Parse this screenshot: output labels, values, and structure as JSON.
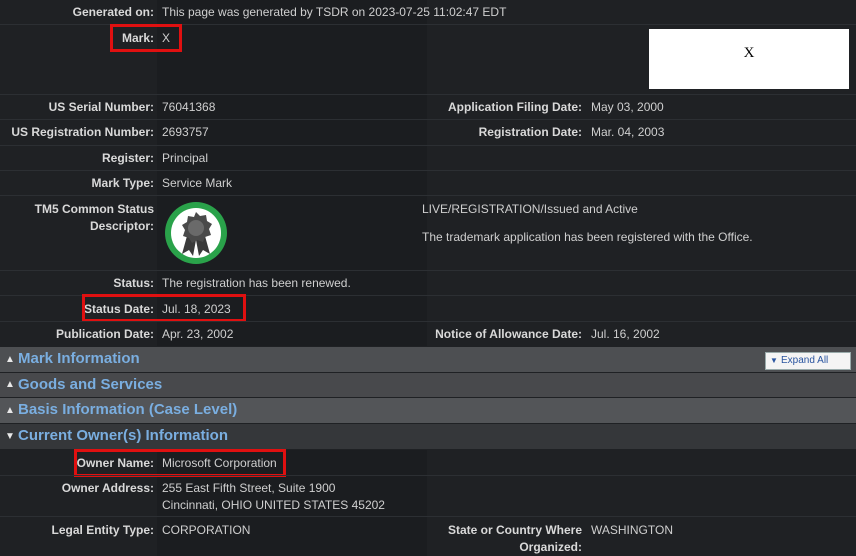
{
  "header": {
    "generated_label": "Generated on:",
    "generated_value": "This page was generated by TSDR on 2023-07-25 11:02:47 EDT"
  },
  "mark": {
    "label": "Mark:",
    "value": "X",
    "image_text": "X"
  },
  "fields": {
    "serial_label": "US Serial Number:",
    "serial_value": "76041368",
    "filing_label": "Application Filing Date:",
    "filing_value": "May 03, 2000",
    "regnum_label": "US Registration Number:",
    "regnum_value": "2693757",
    "regdate_label": "Registration Date:",
    "regdate_value": "Mar. 04, 2003",
    "register_label": "Register:",
    "register_value": "Principal",
    "marktype_label": "Mark Type:",
    "marktype_value": "Service Mark",
    "tm5_label_1": "TM5 Common Status",
    "tm5_label_2": "Descriptor:",
    "tm5_status": "LIVE/REGISTRATION/Issued and Active",
    "tm5_desc": "The trademark application has been registered with the Office.",
    "status_label": "Status:",
    "status_value": "The registration has been renewed.",
    "statusdate_label": "Status Date:",
    "statusdate_value": "Jul. 18, 2023",
    "pubdate_label": "Publication Date:",
    "pubdate_value": "Apr. 23, 2002",
    "allowance_label": "Notice of Allowance Date:",
    "allowance_value": "Jul. 16, 2002"
  },
  "sections": {
    "mark_info": "Mark Information",
    "goods": "Goods and Services",
    "basis": "Basis Information (Case Level)",
    "owner": "Current Owner(s) Information",
    "expand_all": "Expand All"
  },
  "owner": {
    "name_label": "Owner Name:",
    "name_value": "Microsoft Corporation",
    "address_label": "Owner Address:",
    "address_line1": "255 East Fifth Street, Suite 1900",
    "address_line2": "Cincinnati, OHIO UNITED STATES 45202",
    "entity_label": "Legal Entity Type:",
    "entity_value": "CORPORATION",
    "state_label_1": "State or Country Where",
    "state_label_2": "Organized:",
    "state_value": "WASHINGTON"
  },
  "colors": {
    "highlight": "#e01010",
    "link": "#7aaee0",
    "badge_ring": "#2aa24a"
  }
}
